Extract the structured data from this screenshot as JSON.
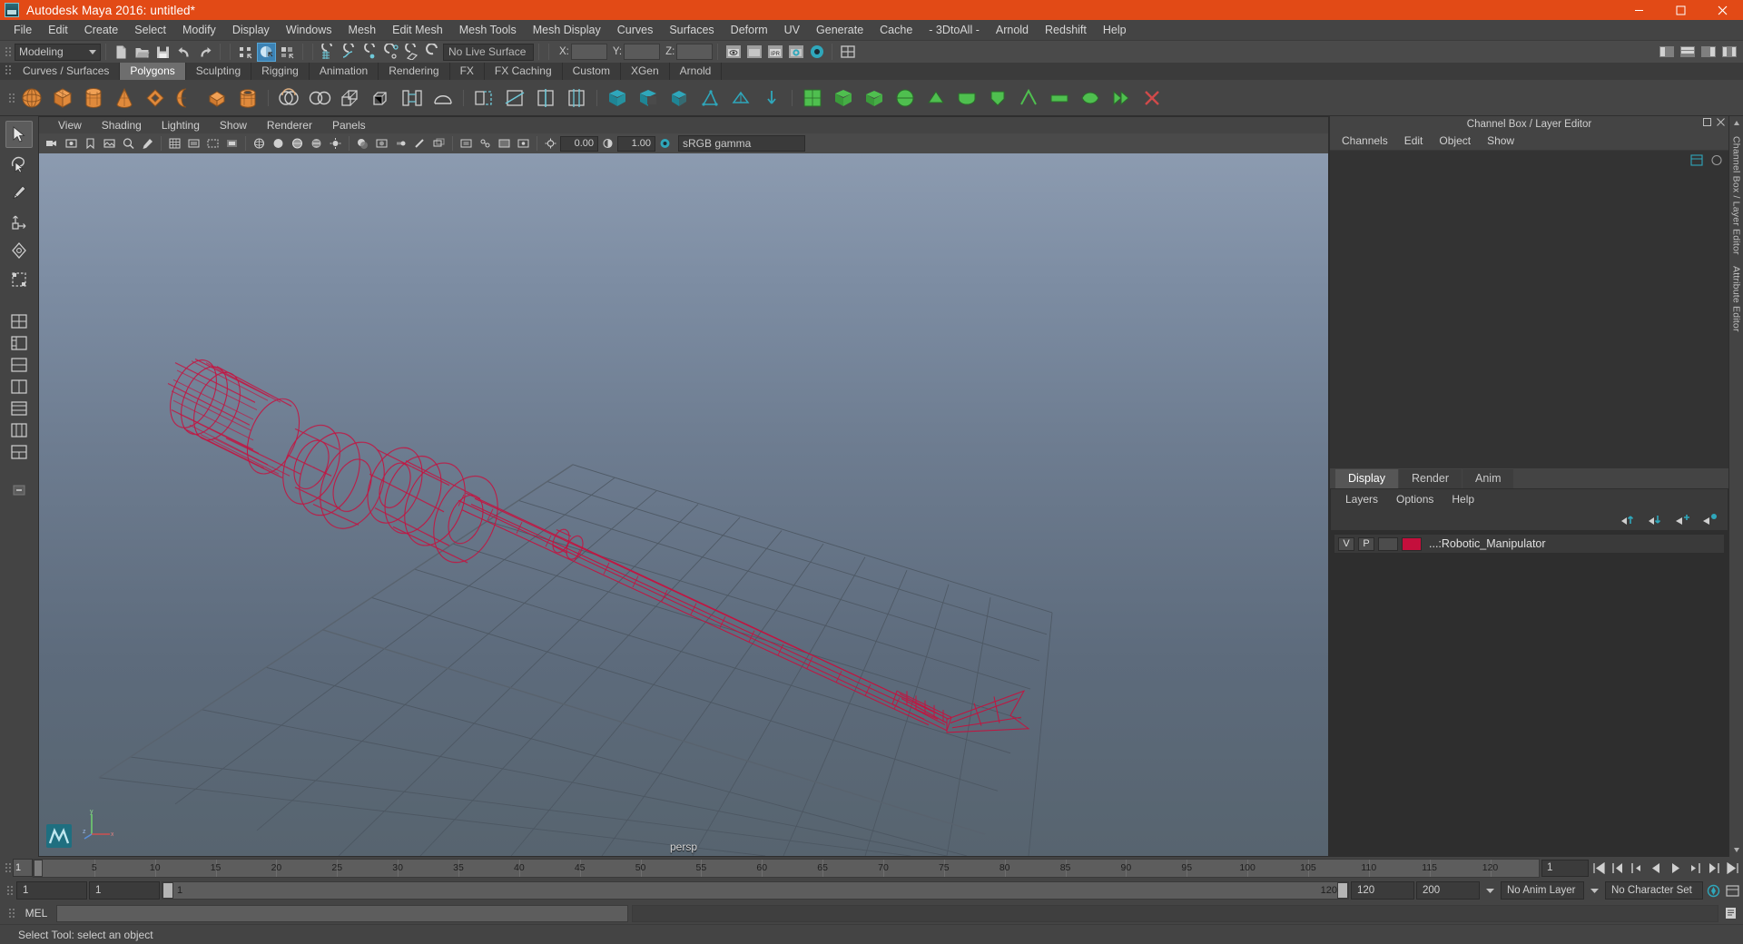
{
  "window": {
    "title": "Autodesk Maya 2016: untitled*",
    "logo_icon": "maya-logo-icon",
    "minimize_icon": "minimize-icon",
    "maximize_icon": "maximize-icon",
    "close_icon": "close-icon"
  },
  "menubar": {
    "items": [
      "File",
      "Edit",
      "Create",
      "Select",
      "Modify",
      "Display",
      "Windows",
      "Mesh",
      "Edit Mesh",
      "Mesh Tools",
      "Mesh Display",
      "Curves",
      "Surfaces",
      "Deform",
      "UV",
      "Generate",
      "Cache",
      "- 3DtoAll -",
      "Arnold",
      "Redshift",
      "Help"
    ]
  },
  "statusbar": {
    "menuset": "Modeling",
    "live_surface": "No Live Surface",
    "coord_x_label": "X:",
    "coord_y_label": "Y:",
    "coord_z_label": "Z:",
    "coord_x_value": "",
    "coord_y_value": "",
    "coord_z_value": "",
    "icons": {
      "new_scene": "new-scene-icon",
      "open_scene": "open-scene-icon",
      "save_scene": "save-scene-icon",
      "undo": "undo-icon",
      "redo": "redo-icon",
      "select_hierarchy": "select-by-hierarchy-icon",
      "select_object": "select-by-object-type-icon",
      "select_component": "select-by-component-type-icon",
      "snap_grid": "snap-to-grid-icon",
      "snap_curve": "snap-to-curve-icon",
      "snap_point": "snap-to-point-icon",
      "snap_projected": "snap-to-projected-center-icon",
      "snap_view_plane": "snap-to-view-plane-icon",
      "make_live": "make-live-icon",
      "render_view": "render-view-icon",
      "render_current": "render-current-frame-icon",
      "ipr_render": "ipr-render-icon",
      "render_settings": "render-settings-icon",
      "hypershade": "hypershade-icon",
      "sidebar_toggle_1": "show-hide-channel-box-icon",
      "sidebar_toggle_2": "show-hide-attribute-editor-icon",
      "sidebar_toggle_3": "show-hide-tool-settings-icon"
    }
  },
  "shelf": {
    "tabs": [
      "Curves / Surfaces",
      "Polygons",
      "Sculpting",
      "Rigging",
      "Animation",
      "Rendering",
      "FX",
      "FX Caching",
      "Custom",
      "XGen",
      "Arnold"
    ],
    "active_tab": "Polygons",
    "buttons": [
      {
        "name": "polygon-sphere-icon",
        "color": "#e08a3c"
      },
      {
        "name": "polygon-cube-icon",
        "color": "#e08a3c"
      },
      {
        "name": "polygon-cylinder-icon",
        "color": "#e08a3c"
      },
      {
        "name": "polygon-cone-icon",
        "color": "#e08a3c"
      },
      {
        "name": "polygon-torus-icon",
        "color": "#e08a3c"
      },
      {
        "name": "polygon-plane-icon",
        "color": "#e08a3c"
      },
      {
        "name": "polygon-prism-icon",
        "color": "#e08a3c"
      },
      {
        "name": "polygon-pipe-icon",
        "color": "#e08a3c"
      },
      {
        "name": "combine-icon",
        "color": "#d2d2d2"
      },
      {
        "name": "separate-icon",
        "color": "#d2d2d2"
      },
      {
        "name": "extrude-icon",
        "color": "#d2d2d2"
      },
      {
        "name": "bevel-icon",
        "color": "#d2d2d2"
      },
      {
        "name": "bridge-icon",
        "color": "#d2d2d2"
      },
      {
        "name": "smooth-icon",
        "color": "#d2d2d2"
      },
      {
        "name": "append-polygon-icon",
        "color": "#d2d2d2"
      },
      {
        "name": "multi-cut-icon",
        "color": "#d2d2d2"
      },
      {
        "name": "insert-edge-loop-icon",
        "color": "#d2d2d2"
      },
      {
        "name": "offset-edge-loop-icon",
        "color": "#d2d2d2"
      },
      {
        "name": "mirror-geometry-icon",
        "color": "#d2d2d2"
      },
      {
        "name": "boolean-union-icon",
        "color": "#4fc8d8"
      },
      {
        "name": "boolean-difference-icon",
        "color": "#4fc8d8"
      },
      {
        "name": "boolean-intersection-icon",
        "color": "#4fc8d8"
      },
      {
        "name": "quad-draw-icon",
        "color": "#4fc8d8"
      },
      {
        "name": "uv-editor-icon",
        "color": "#4fc8d8"
      },
      {
        "name": "sculpt-tool-icon",
        "color": "#4fc8d8"
      }
    ]
  },
  "toolbox": {
    "items": [
      {
        "name": "select-tool",
        "label": "Select Tool",
        "active": true
      },
      {
        "name": "lasso-select-tool",
        "label": "Lasso Select Tool",
        "active": false
      },
      {
        "name": "paint-select-tool",
        "label": "Paint Selection Tool",
        "active": false
      },
      {
        "name": "move-tool",
        "label": "Move Tool",
        "active": false
      },
      {
        "name": "rotate-tool",
        "label": "Rotate Tool",
        "active": false
      },
      {
        "name": "scale-tool",
        "label": "Scale Tool",
        "active": false
      }
    ],
    "layouts": [
      {
        "name": "single-perspective-layout"
      },
      {
        "name": "four-view-layout"
      },
      {
        "name": "outliner-persp-layout"
      },
      {
        "name": "persp-graph-layout"
      },
      {
        "name": "hypershade-persp-layout"
      },
      {
        "name": "two-panes-side-layout"
      },
      {
        "name": "two-panes-stacked-layout"
      }
    ]
  },
  "viewport": {
    "panel_menus": [
      "View",
      "Shading",
      "Lighting",
      "Show",
      "Renderer",
      "Panels"
    ],
    "camera_label": "persp",
    "exposure_value": "0.00",
    "gamma_value": "1.00",
    "color_space": "sRGB gamma",
    "color_space_icon": "color-management-icon",
    "axis_gizmo_icon": "axis-gizmo-icon",
    "maya_badge_icon": "maya-badge-icon",
    "toolbar_icons": [
      "select-camera-icon",
      "camera-attributes-icon",
      "bookmark-icon",
      "image-plane-icon",
      "two-d-pan-zoom-icon",
      "grease-pencil-icon",
      "grid-toggle-icon",
      "film-gate-icon",
      "resolution-gate-icon",
      "gate-mask-icon",
      "wireframe-icon",
      "smooth-shade-icon",
      "shaded-wireframe-icon",
      "textured-icon",
      "lighting-icon",
      "shadows-icon",
      "screen-space-ao-icon",
      "motion-blur-icon",
      "multisample-icon",
      "depth-peeling-icon",
      "xray-mode-icon",
      "xray-joints-icon",
      "xray-active-icon",
      "isolate-select-icon",
      "exposure-icon",
      "gamma-icon"
    ],
    "scene_object": "Robotic_Manipulator wireframe"
  },
  "rightpanel": {
    "title": "Channel Box / Layer Editor",
    "float_icon": "undock-icon",
    "close_icon": "close-icon",
    "menus": [
      "Channels",
      "Edit",
      "Object",
      "Show"
    ],
    "channelbox_icons": [
      "channel-box-toggle-icon",
      "layer-editor-toggle-icon"
    ],
    "layer_tabs": [
      "Display",
      "Render",
      "Anim"
    ],
    "layer_tab_active": "Display",
    "layer_menus": [
      "Layers",
      "Options",
      "Help"
    ],
    "layer_tool_icons": [
      "move-layer-up-icon",
      "move-layer-down-icon",
      "new-layer-icon",
      "new-layer-from-selected-icon"
    ],
    "layers": [
      {
        "visibility": "V",
        "playback": "P",
        "color": "#c40f3c",
        "name": "...:Robotic_Manipulator"
      }
    ]
  },
  "rightedge": {
    "tabs": [
      "Channel Box / Layer Editor",
      "Attribute Editor"
    ]
  },
  "timeslider": {
    "current_frame_left": "1",
    "current_frame_field": "1",
    "ticks": [
      5,
      10,
      15,
      20,
      25,
      30,
      35,
      40,
      45,
      50,
      55,
      60,
      65,
      70,
      75,
      80,
      85,
      90,
      95,
      100,
      105,
      110,
      115,
      120
    ],
    "range_start": "1",
    "range_end": "1",
    "anim_start": "1",
    "anim_end_inner": "120",
    "anim_end": "120",
    "playback_end": "200",
    "anim_layer": "No Anim Layer",
    "character_set": "No Character Set",
    "transport_icons": [
      "go-to-start-icon",
      "step-back-key-icon",
      "step-back-frame-icon",
      "play-backwards-icon",
      "play-forwards-icon",
      "step-forward-frame-icon",
      "step-forward-key-icon",
      "go-to-end-icon"
    ],
    "auto_key_icon": "auto-keyframe-icon",
    "anim_prefs_icon": "animation-preferences-icon",
    "range_slider_icon": "range-slider-icon"
  },
  "command": {
    "prompt_label": "MEL",
    "input_value": "",
    "script_editor_icon": "script-editor-icon"
  },
  "statusline": {
    "message": "Select Tool: select an object"
  },
  "colors": {
    "title_bar": "#e24a16",
    "accent_blue": "#3c82b4",
    "shelf_orange": "#e08a3c",
    "teal": "#4fc8d8",
    "layer_red": "#c40f3c",
    "wireframe_red": "#c8103e"
  }
}
